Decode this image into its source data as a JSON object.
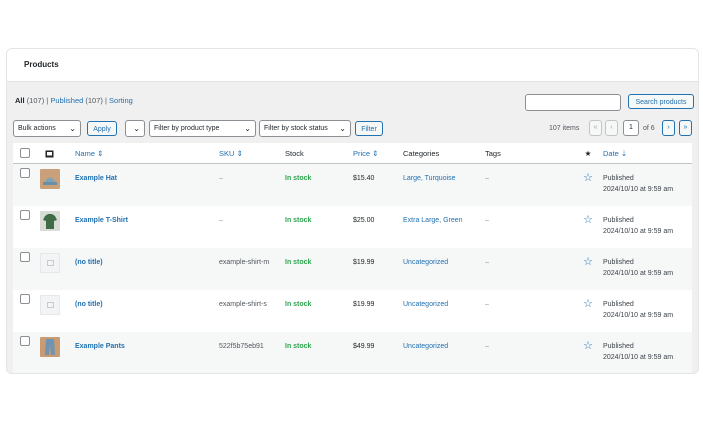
{
  "page": {
    "title": "Products"
  },
  "views": {
    "all_label": "All",
    "all_count": "(107)",
    "published_label": "Published",
    "published_count": "(107)",
    "sorting_label": "Sorting",
    "sep": "|"
  },
  "search": {
    "button_label": "Search products",
    "value": ""
  },
  "filters": {
    "bulk_actions": "Bulk actions",
    "apply": "Apply",
    "blank_select": "",
    "product_type": "Filter by product type",
    "stock_status": "Filter by stock status",
    "filter": "Filter"
  },
  "pagination": {
    "items": "107 items",
    "first": "«",
    "prev": "‹",
    "current": "1",
    "of": "of 6",
    "next": "›",
    "last": "»"
  },
  "table": {
    "columns": {
      "name": "Name ⇕",
      "sku": "SKU ⇕",
      "stock": "Stock",
      "price": "Price ⇕",
      "categories": "Categories",
      "tags": "Tags",
      "featured": "★",
      "date": "Date ⇣"
    },
    "rows": [
      {
        "name": "Example Hat",
        "sku": "–",
        "stock": "In stock",
        "price": "$15.40",
        "categories": "Large, Turquoise",
        "tags": "–",
        "status": "Published",
        "date": "2024/10/10 at 9:59 am",
        "thumb": "hat"
      },
      {
        "name": "Example T-Shirt",
        "sku": "–",
        "stock": "In stock",
        "price": "$25.00",
        "categories": "Extra Large, Green",
        "tags": "–",
        "status": "Published",
        "date": "2024/10/10 at 9:59 am",
        "thumb": "tshirt"
      },
      {
        "name": "(no title)",
        "sku": "example-shirt-m",
        "stock": "In stock",
        "price": "$19.99",
        "categories": "Uncategorized",
        "tags": "–",
        "status": "Published",
        "date": "2024/10/10 at 9:59 am",
        "thumb": "placeholder"
      },
      {
        "name": "(no title)",
        "sku": "example-shirt-s",
        "stock": "In stock",
        "price": "$19.99",
        "categories": "Uncategorized",
        "tags": "–",
        "status": "Published",
        "date": "2024/10/10 at 9:59 am",
        "thumb": "placeholder"
      },
      {
        "name": "Example Pants",
        "sku": "522f5b75eb91",
        "stock": "In stock",
        "price": "$49.99",
        "categories": "Uncategorized",
        "tags": "–",
        "status": "Published",
        "date": "2024/10/10 at 9:59 am",
        "thumb": "pants"
      }
    ]
  },
  "colors": {
    "link": "#2271b1",
    "in_stock": "#2ea44f",
    "border": "#c3c4c7"
  },
  "icons": {
    "image_column": "image-icon",
    "featured": "star-icon",
    "dropdown": "chevron-down-icon"
  }
}
